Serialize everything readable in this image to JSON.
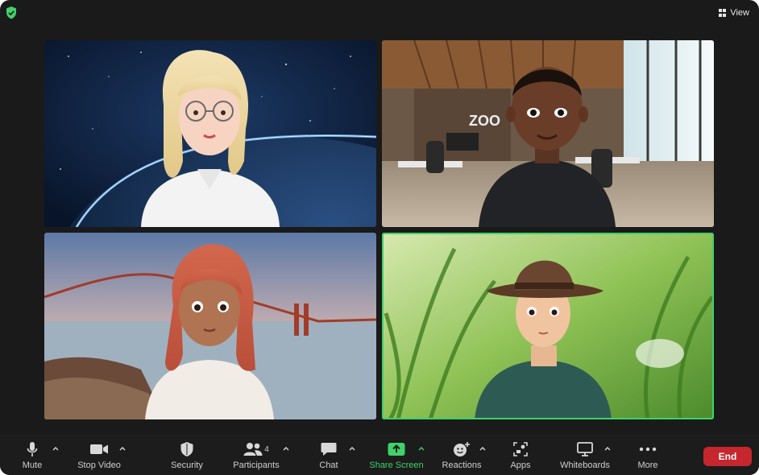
{
  "window": {
    "view_label": "View"
  },
  "tiles": [
    {
      "name": "video-tile-space-avatar",
      "background": "space",
      "active": false
    },
    {
      "name": "video-tile-office-avatar",
      "background": "office",
      "active": false
    },
    {
      "name": "video-tile-bridge-avatar",
      "background": "bridge",
      "active": false
    },
    {
      "name": "video-tile-grass-avatar",
      "background": "grass",
      "active": true
    }
  ],
  "office_sign": "ZOO",
  "toolbar": {
    "mute": "Mute",
    "stop_video": "Stop Video",
    "security": "Security",
    "participants": "Participants",
    "participants_count": "4",
    "chat": "Chat",
    "share_screen": "Share Screen",
    "reactions": "Reactions",
    "apps": "Apps",
    "whiteboards": "Whiteboards",
    "more": "More",
    "end": "End"
  },
  "colors": {
    "accent_green": "#3fd16a",
    "end_red": "#c6262e",
    "window_bg": "#1a1a1a"
  }
}
